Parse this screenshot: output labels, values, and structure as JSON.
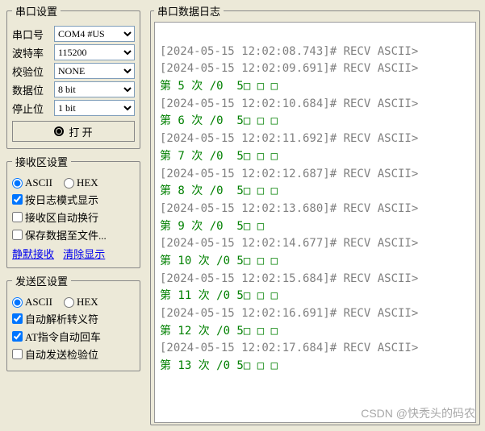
{
  "serial": {
    "legend": "串口设置",
    "port_label": "串口号",
    "port_value": "COM4 #US",
    "baud_label": "波特率",
    "baud_value": "115200",
    "parity_label": "校验位",
    "parity_value": "NONE",
    "databits_label": "数据位",
    "databits_value": "8 bit",
    "stopbits_label": "停止位",
    "stopbits_value": "1 bit",
    "open_label": "打 开"
  },
  "recv": {
    "legend": "接收区设置",
    "ascii_label": "ASCII",
    "hex_label": "HEX",
    "log_mode": "按日志模式显示",
    "auto_wrap": "接收区自动换行",
    "save_file": "保存数据至文件...",
    "mute_link": "静默接收",
    "clear_link": "清除显示"
  },
  "send": {
    "legend": "发送区设置",
    "ascii_label": "ASCII",
    "hex_label": "HEX",
    "auto_escape": "自动解析转义符",
    "at_newline": "AT指令自动回车",
    "auto_checksum": "自动发送检验位"
  },
  "log": {
    "legend": "串口数据日志",
    "entries": [
      {
        "ts": "[2024-05-15 12:02:08.743]# RECV ASCII>",
        "msg": ""
      },
      {
        "ts": "[2024-05-15 12:02:09.691]# RECV ASCII>",
        "msg": "第 5 次 /0  5□ □ □"
      },
      {
        "ts": "[2024-05-15 12:02:10.684]# RECV ASCII>",
        "msg": "第 6 次 /0  5□ □ □"
      },
      {
        "ts": "[2024-05-15 12:02:11.692]# RECV ASCII>",
        "msg": "第 7 次 /0  5□ □ □"
      },
      {
        "ts": "[2024-05-15 12:02:12.687]# RECV ASCII>",
        "msg": "第 8 次 /0  5□ □ □"
      },
      {
        "ts": "[2024-05-15 12:02:13.680]# RECV ASCII>",
        "msg": "第 9 次 /0  5□ □"
      },
      {
        "ts": "[2024-05-15 12:02:14.677]# RECV ASCII>",
        "msg": "第 10 次 /0 5□ □ □"
      },
      {
        "ts": "[2024-05-15 12:02:15.684]# RECV ASCII>",
        "msg": "第 11 次 /0 5□ □ □"
      },
      {
        "ts": "[2024-05-15 12:02:16.691]# RECV ASCII>",
        "msg": "第 12 次 /0 5□ □ □"
      },
      {
        "ts": "[2024-05-15 12:02:17.684]# RECV ASCII>",
        "msg": "第 13 次 /0 5□ □ □"
      }
    ]
  },
  "watermark": "CSDN @快秃头的码农"
}
